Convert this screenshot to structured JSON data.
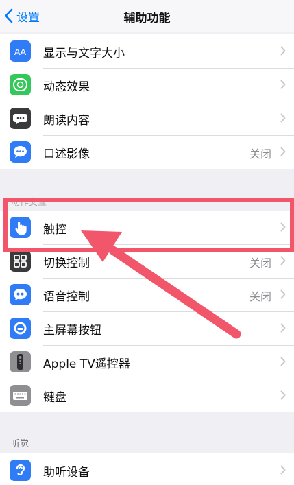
{
  "nav": {
    "back_label": "设置",
    "title": "辅助功能"
  },
  "sections": {
    "vision_items": [
      {
        "label": "显示与文字大小",
        "value": "",
        "icon": "text-size-icon",
        "color": "#2f7cf6"
      },
      {
        "label": "动态效果",
        "value": "",
        "icon": "motion-icon",
        "color": "#34c759"
      },
      {
        "label": "朗读内容",
        "value": "",
        "icon": "speech-icon",
        "color": "#3a3a3c"
      },
      {
        "label": "口述影像",
        "value": "关闭",
        "icon": "audio-description-icon",
        "color": "#2f7cf6"
      }
    ],
    "interaction_header": "动作交互",
    "interaction_items": [
      {
        "label": "触控",
        "value": "",
        "icon": "touch-hand-icon",
        "color": "#2f7cf6"
      },
      {
        "label": "切换控制",
        "value": "关闭",
        "icon": "switch-control-icon",
        "color": "#3a3a3c"
      },
      {
        "label": "语音控制",
        "value": "关闭",
        "icon": "voice-control-icon",
        "color": "#2f7cf6"
      },
      {
        "label": "主屏幕按钮",
        "value": "",
        "icon": "home-button-icon",
        "color": "#2f7cf6"
      },
      {
        "label": "Apple TV遥控器",
        "value": "",
        "icon": "tv-remote-icon",
        "color": "#8e8e93"
      },
      {
        "label": "键盘",
        "value": "",
        "icon": "keyboard-icon",
        "color": "#8e8e93"
      }
    ],
    "hearing_header": "听觉",
    "hearing_items": [
      {
        "label": "助听设备",
        "value": "",
        "icon": "hearing-device-icon",
        "color": "#2f7cf6"
      }
    ]
  },
  "annotation": {
    "highlight_color": "#f2566b"
  }
}
